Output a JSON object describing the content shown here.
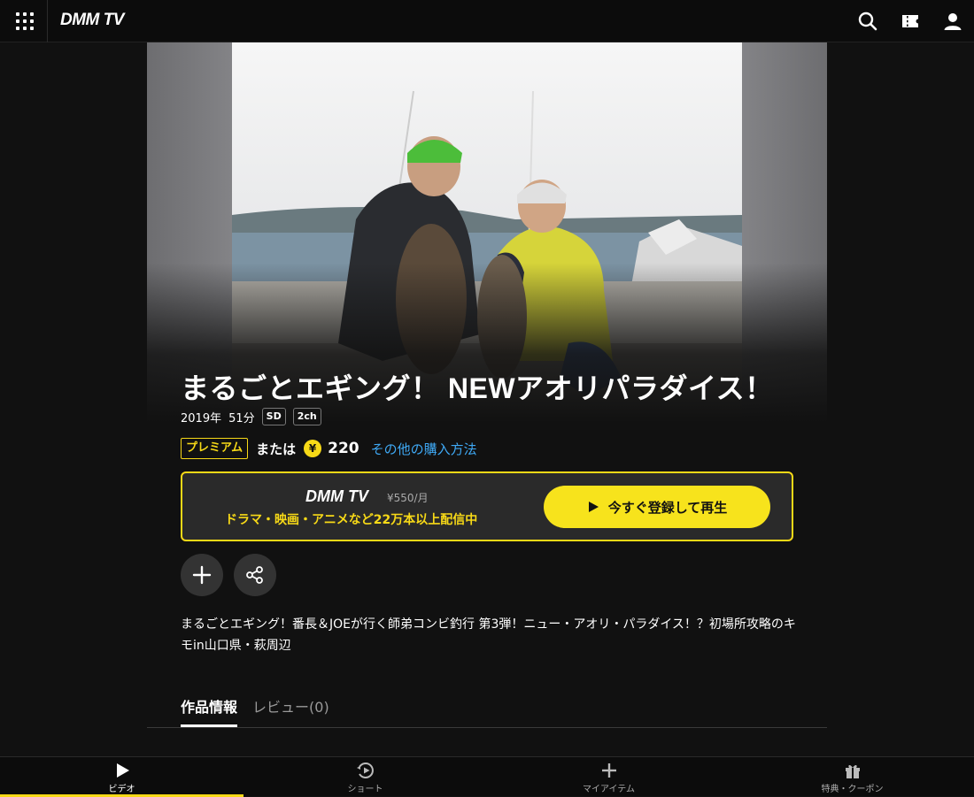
{
  "header": {
    "logo": "DMM TV",
    "icons": [
      "apps-grid-icon",
      "search-icon",
      "ticket-icon",
      "user-icon"
    ]
  },
  "title": {
    "text": "まるごとエギング！ NEWアオリパラダイス！",
    "year": "2019年",
    "duration": "51分",
    "badges": [
      "SD",
      "2ch"
    ]
  },
  "purchase": {
    "premium_label": "プレミアム",
    "or_label": "または",
    "currency_icon": "¥",
    "price": "220",
    "other_methods": "その他の購入方法"
  },
  "promo": {
    "logo": "DMM TV",
    "monthly_price": "¥550/月",
    "tagline": "ドラマ・映画・アニメなど22万本以上配信中",
    "cta": "今すぐ登録して再生"
  },
  "actions": [
    "add-icon",
    "share-icon"
  ],
  "description": "まるごとエギング！番長＆JOEが行く師弟コンビ釣行 第3弾！ニュー・アオリ・パラダイス！？初場所攻略のキモin山口県・萩周辺",
  "tabs": [
    {
      "label": "作品情報",
      "active": true
    },
    {
      "label": "レビュー(0)",
      "active": false
    }
  ],
  "bottom_nav": [
    {
      "label": "ビデオ",
      "icon": "play-icon",
      "active": true
    },
    {
      "label": "ショート",
      "icon": "shorts-icon",
      "active": false
    },
    {
      "label": "マイアイテム",
      "icon": "plus-icon",
      "active": false
    },
    {
      "label": "特典・クーポン",
      "icon": "gift-icon",
      "active": false
    }
  ],
  "colors": {
    "accent": "#f7d917",
    "link": "#3fa9f5",
    "background": "#111111"
  }
}
